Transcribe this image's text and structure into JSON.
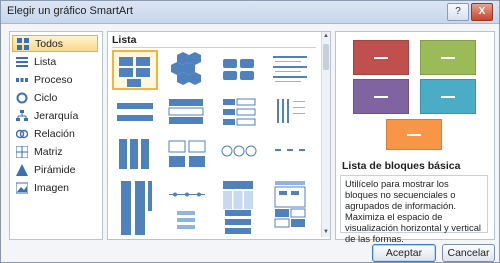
{
  "window": {
    "title": "Elegir un gráfico SmartArt",
    "help_label": "?",
    "close_label": "X"
  },
  "categories": [
    {
      "label": "Todos",
      "icon": "grid-icon",
      "selected": true
    },
    {
      "label": "Lista",
      "icon": "list-icon"
    },
    {
      "label": "Proceso",
      "icon": "process-icon"
    },
    {
      "label": "Ciclo",
      "icon": "cycle-icon"
    },
    {
      "label": "Jerarquía",
      "icon": "hierarchy-icon"
    },
    {
      "label": "Relación",
      "icon": "relationship-icon"
    },
    {
      "label": "Matriz",
      "icon": "matrix-icon"
    },
    {
      "label": "Pirámide",
      "icon": "pyramid-icon"
    },
    {
      "label": "Imagen",
      "icon": "picture-icon"
    }
  ],
  "gallery": {
    "heading": "Lista",
    "selected_layout": "Lista de bloques básica"
  },
  "preview": {
    "name": "Lista de bloques básica",
    "description": "Utilícelo para mostrar los bloques no secuenciales o agrupados de información. Maximiza el espacio de visualización horizontal y vertical de las formas.",
    "colors": [
      "#c0504d",
      "#9bbb59",
      "#8064a2",
      "#4bacc6",
      "#f79646"
    ]
  },
  "buttons": {
    "ok": "Aceptar",
    "cancel": "Cancelar"
  }
}
